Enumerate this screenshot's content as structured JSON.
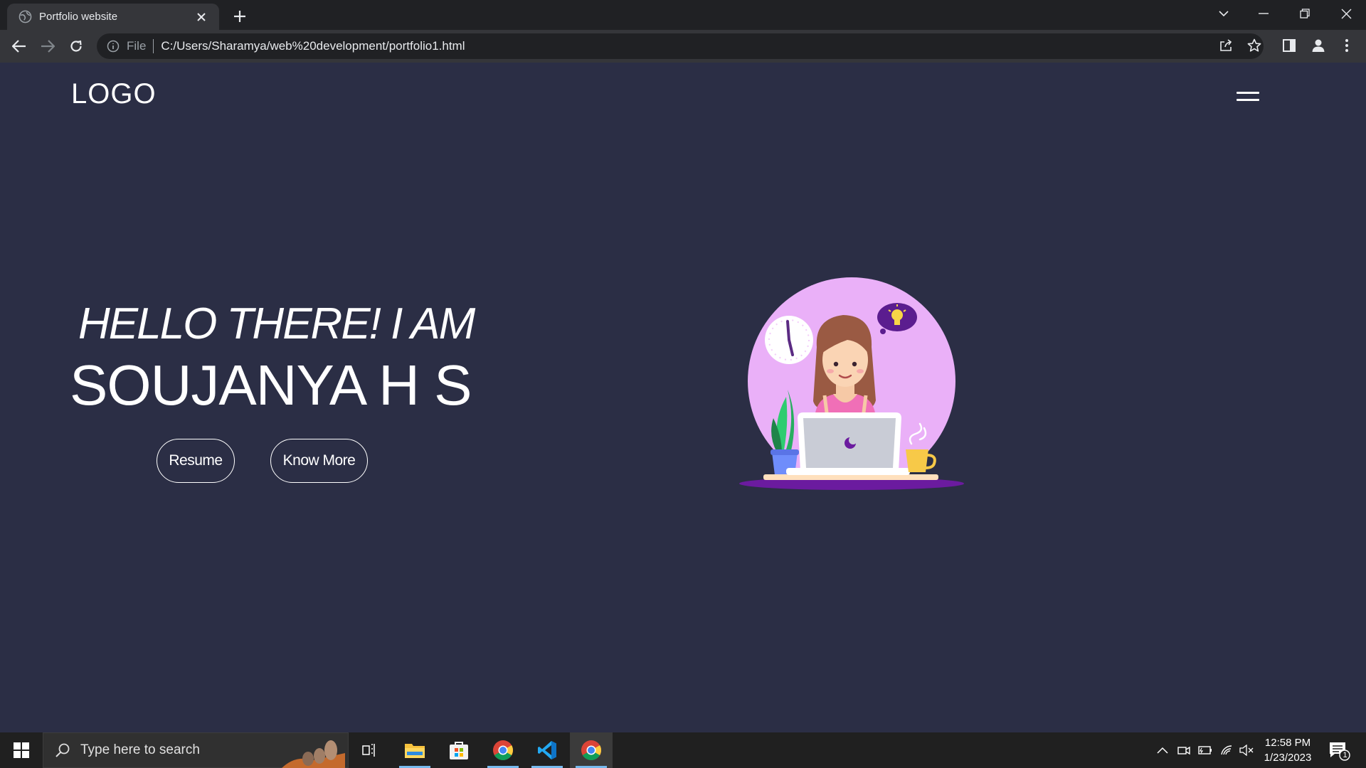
{
  "browser": {
    "tab_title": "Portfolio website",
    "scheme_label": "File",
    "url": "C:/Users/Sharamya/web%20development/portfolio1.html",
    "icons": [
      "globe-icon",
      "close-icon",
      "plus-icon",
      "chevron-down-icon",
      "minimize-icon",
      "restore-icon",
      "window-close-icon",
      "back-arrow-icon",
      "forward-arrow-icon",
      "reload-icon",
      "info-icon",
      "share-icon",
      "star-icon",
      "side-panel-icon",
      "profile-icon",
      "kebab-menu-icon"
    ]
  },
  "page": {
    "logo": "LOGO",
    "greeting": "HELLO THERE! I AM",
    "name": "SOUJANYA H S",
    "buttons": {
      "resume": "Resume",
      "know_more": "Know More"
    },
    "colors": {
      "background": "#2b2e45",
      "illustration_circle": "#eab0f8",
      "text": "#ffffff"
    }
  },
  "taskbar": {
    "search_placeholder": "Type here to search",
    "time": "12:58 PM",
    "date": "1/23/2023",
    "notification_count": "1",
    "apps": [
      "task-view",
      "file-explorer",
      "microsoft-store",
      "chrome",
      "vscode",
      "chrome"
    ]
  }
}
